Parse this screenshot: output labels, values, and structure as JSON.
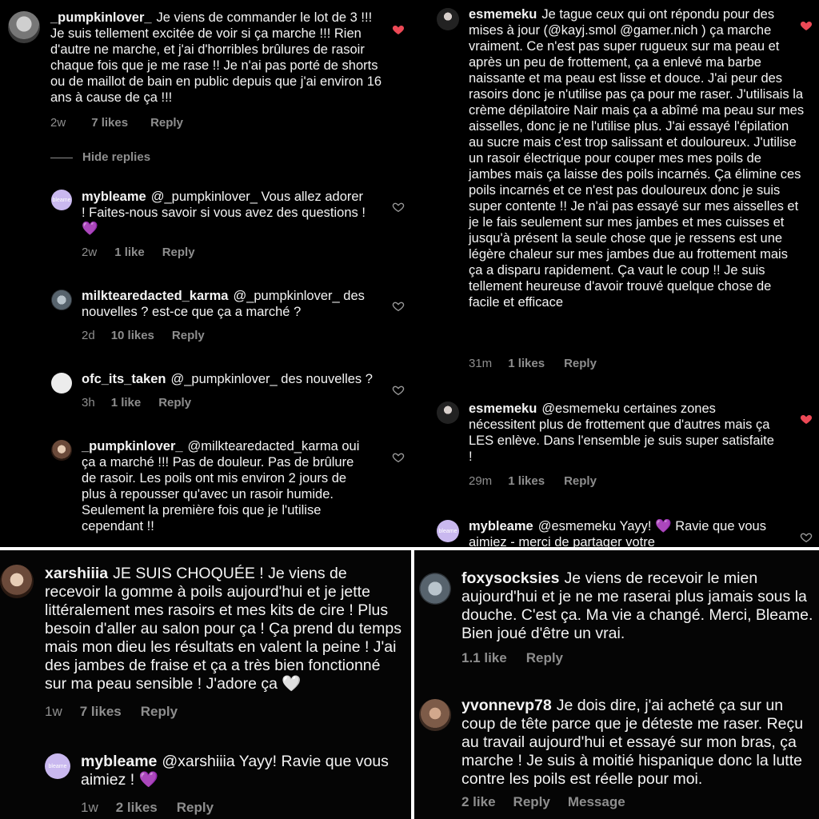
{
  "heart_liked_color": "#ed4956",
  "emoji_heart_purple": "💜",
  "emoji_heart_white": "🤍",
  "actions": {
    "reply": "Reply",
    "message": "Message",
    "hide_replies": "Hide replies"
  },
  "top_left": [
    {
      "username": "_pumpkinlover_",
      "text": "Je viens de commander le lot de 3 !!! Je suis tellement excitée de voir si ça marche !!! Rien d'autre ne marche, et j'ai d'horribles brûlures de rasoir chaque fois que je me rase !! Je n'ai pas porté de shorts ou de maillot de bain en public depuis que j'ai environ 16 ans à cause de ça !!!",
      "time": "2w",
      "likes": "7 likes",
      "liked": true
    },
    {
      "username": "mybleame",
      "avatar_text": "bleame",
      "text": "@_pumpkinlover_ Vous allez adorer ! Faites-nous savoir si vous avez des questions !",
      "emoji": "💜",
      "time": "2w",
      "likes": "1 like",
      "liked": false
    },
    {
      "username": "milktearedacted_karma",
      "text": "@_pumpkinlover_ des nouvelles ? est-ce que ça a marché ?",
      "time": "2d",
      "likes": "10 likes",
      "liked": false
    },
    {
      "username": "ofc_its_taken",
      "text": "@_pumpkinlover_ des nouvelles ?",
      "time": "3h",
      "likes": "1 like",
      "liked": false
    },
    {
      "username": "_pumpkinlover_",
      "text": "@milktearedacted_karma oui ça a marché !!! Pas de douleur. Pas de brûlure de rasoir. Les poils ont mis environ 2 jours de plus à repousser qu'avec un rasoir humide. Seulement la première fois que je l'utilise cependant !!",
      "liked": false
    }
  ],
  "top_right": [
    {
      "username": "esmemeku",
      "text": "Je tague ceux qui ont répondu pour des mises à jour (@kayj.smol @gamer.nich ) ça marche vraiment. Ce n'est pas super rugueux sur ma peau et après un peu de frottement, ça a enlevé ma barbe naissante et ma peau est lisse et douce. J'ai peur des rasoirs donc je n'utilise pas ça pour me raser. J'utilisais la crème dépilatoire Nair mais ça a abîmé ma peau sur mes aisselles, donc je ne l'utilise plus. J'ai essayé l'épilation au sucre mais c'est trop salissant et douloureux. J'utilise un rasoir électrique pour couper mes mes poils de jambes mais ça laisse des poils incarnés. Ça élimine ces poils incarnés et ce n'est pas douloureux donc je suis super contente !! Je n'ai pas essayé sur mes aisselles et je le fais seulement sur mes jambes et mes cuisses et jusqu'à présent la seule chose que je ressens est une légère chaleur sur mes jambes due au frottement mais ça a disparu rapidement. Ça vaut le coup !! Je suis tellement heureuse d'avoir trouvé quelque chose de facile et efficace",
      "time": "31m",
      "likes": "1 likes",
      "liked": true
    },
    {
      "username": "esmemeku",
      "text": "@esmemeku certaines zones nécessitent plus de frottement que d'autres mais ça LES enlève. Dans l'ensemble je suis super satisfaite !",
      "time": "29m",
      "likes": "1 likes",
      "liked": true
    },
    {
      "username": "mybleame",
      "avatar_text": "bleame",
      "text": "@esmemeku Yayy! 💜 Ravie que vous aimiez - merci de partager votre",
      "liked": false
    }
  ],
  "bottom_left": [
    {
      "username": "xarshiiia",
      "text": "JE SUIS CHOQUÉE ! Je viens de recevoir la gomme à poils aujourd'hui et je jette littéralement mes rasoirs et mes kits de cire ! Plus besoin d'aller au salon pour ça ! Ça prend du temps mais mon dieu les résultats en valent la peine ! J'ai des jambes de fraise et ça a très bien fonctionné sur ma peau sensible ! J'adore ça",
      "emoji": "🤍",
      "time": "1w",
      "likes": "7 likes"
    },
    {
      "username": "mybleame",
      "avatar_text": "bleame",
      "text": "@xarshiiia Yayy! Ravie que vous aimiez !",
      "emoji": "💜",
      "time": "1w",
      "likes": "2 likes"
    }
  ],
  "bottom_right": [
    {
      "username": "foxysocksies",
      "text": "Je viens de recevoir le mien aujourd'hui et je ne me raserai plus jamais sous la douche. C'est ça. Ma vie a changé. Merci, Bleame. Bien joué d'être un vrai.",
      "likes": "1.1 like"
    },
    {
      "username": "yvonnevp78",
      "text": "Je dois dire, j'ai acheté ça sur un coup de tête parce que je déteste me raser. Reçu au travail aujourd'hui et essayé sur mon bras, ça marche ! Je suis à moitié hispanique donc la lutte contre les poils est réelle pour moi.",
      "likes": "2 like"
    }
  ]
}
